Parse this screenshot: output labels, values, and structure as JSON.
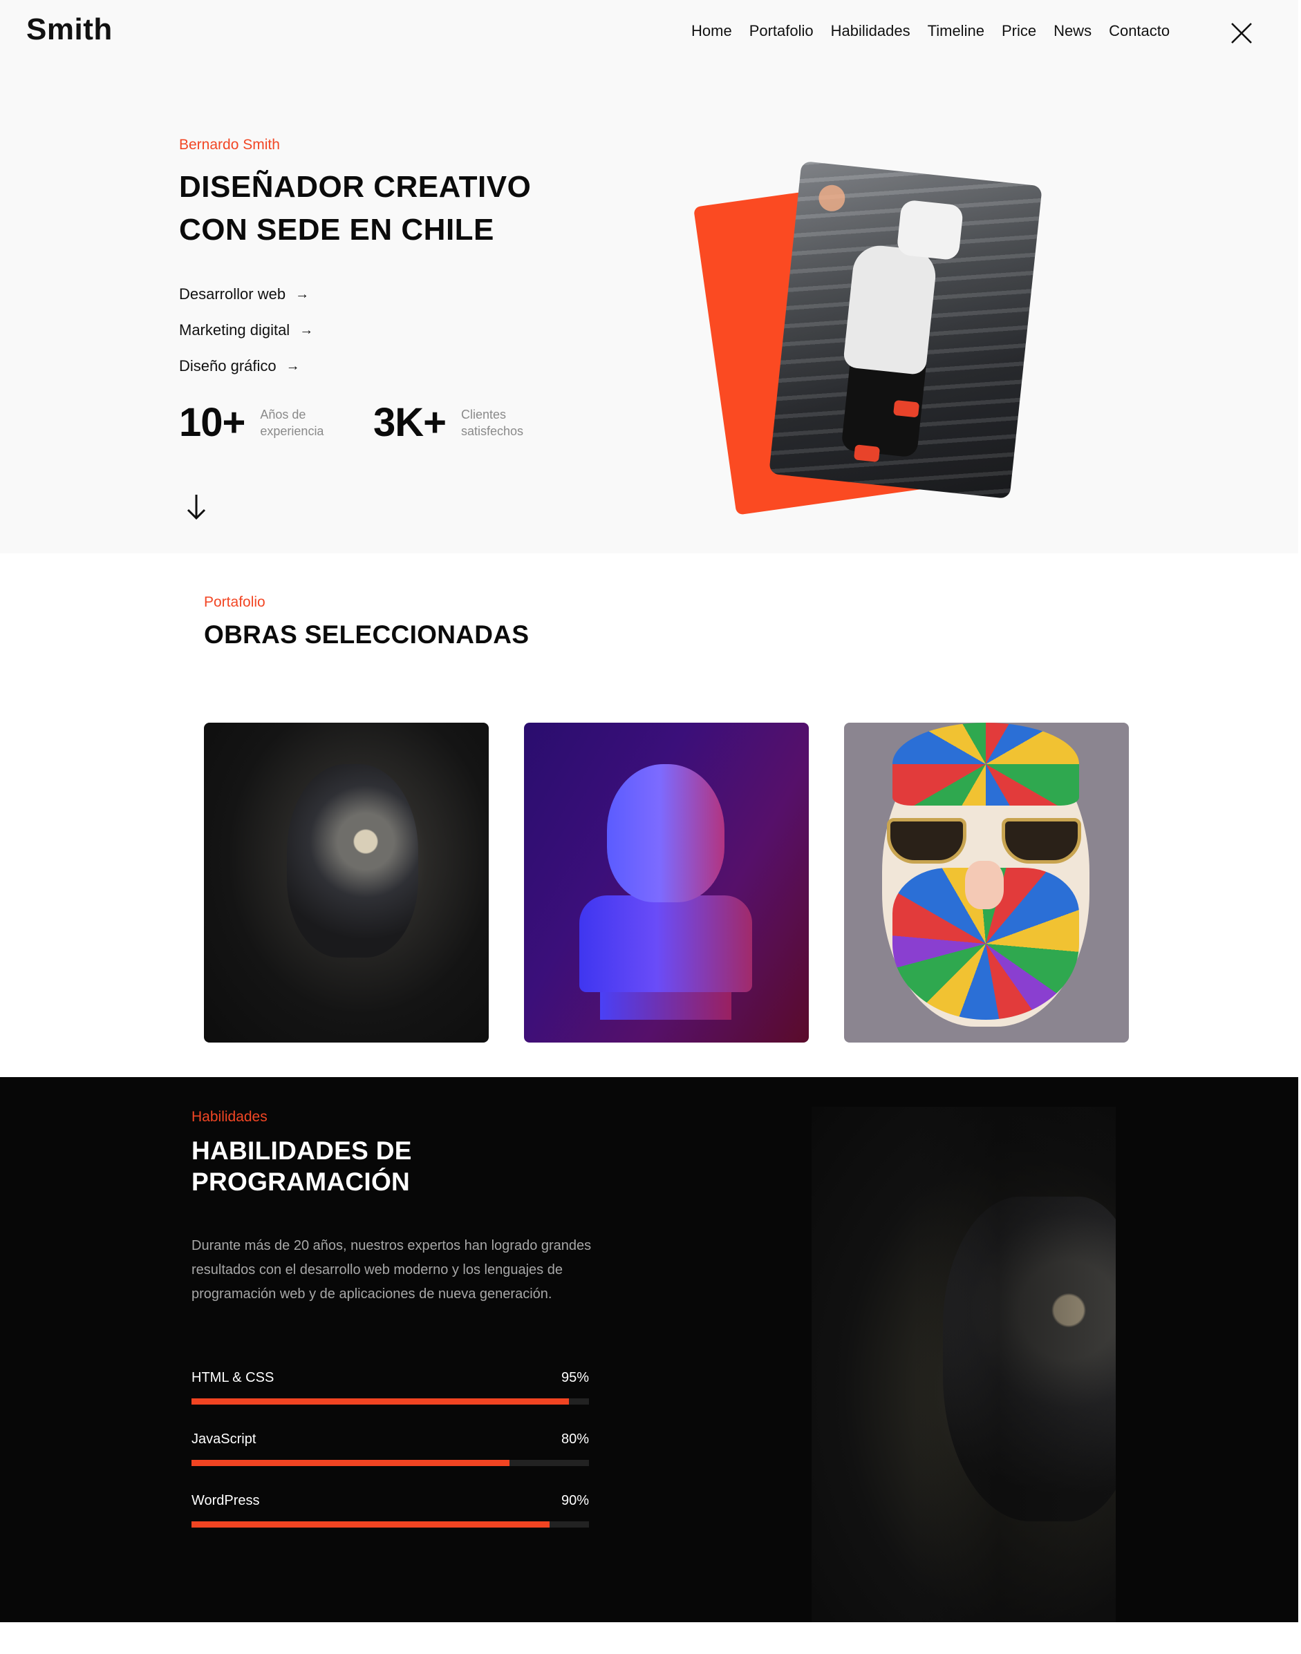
{
  "header": {
    "logo": "Smith",
    "nav": [
      "Home",
      "Portafolio",
      "Habilidades",
      "Timeline",
      "Price",
      "News",
      "Contacto"
    ]
  },
  "hero": {
    "eyebrow": "Bernardo Smith",
    "title": "DISEÑADOR CREATIVO CON SEDE EN CHILE",
    "services": [
      "Desarrollor web",
      "Marketing digital",
      "Diseño gráfico"
    ],
    "stats": [
      {
        "value": "10+",
        "label": "Años de experiencia"
      },
      {
        "value": "3K+",
        "label": "Clientes satisfechos"
      }
    ]
  },
  "portfolio": {
    "eyebrow": "Portafolio",
    "title": "OBRAS SELECCIONADAS"
  },
  "skills": {
    "eyebrow": "Habilidades",
    "title": "HABILIDADES DE PROGRAMACIÓN",
    "description": "Durante más de 20 años, nuestros expertos han logrado grandes resultados con el desarrollo web moderno y los lenguajes de programación web y de aplicaciones de nueva generación.",
    "items": [
      {
        "name": "HTML & CSS",
        "percent_label": "95%",
        "level": 0.95
      },
      {
        "name": "JavaScript",
        "percent_label": "80%",
        "level": 0.8
      },
      {
        "name": "WordPress",
        "percent_label": "90%",
        "level": 0.9
      }
    ]
  },
  "colors": {
    "accent": "#f24624",
    "dark_bg": "#070707",
    "light_bg": "#f9f9f9"
  },
  "icons": [
    "close-icon",
    "arrow-right-icon",
    "arrow-down-icon"
  ]
}
